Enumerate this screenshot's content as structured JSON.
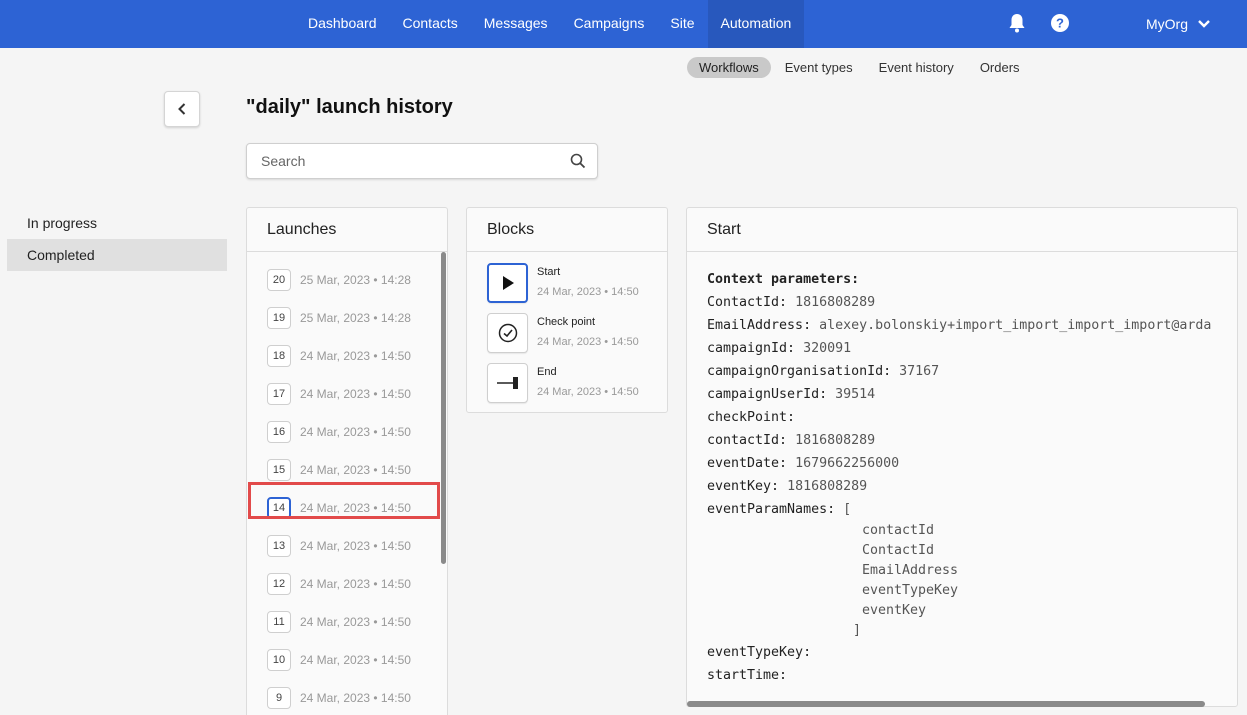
{
  "nav": {
    "items": [
      "Dashboard",
      "Contacts",
      "Messages",
      "Campaigns",
      "Site",
      "Automation"
    ],
    "active": "Automation",
    "org": "MyOrg"
  },
  "subnav": {
    "items": [
      "Workflows",
      "Event types",
      "Event history",
      "Orders"
    ],
    "active": "Workflows"
  },
  "page_title": "\"daily\" launch history",
  "search": {
    "placeholder": "Search"
  },
  "status_filters": [
    "In progress",
    "Completed"
  ],
  "status_active": "Completed",
  "launches": {
    "title": "Launches",
    "rows": [
      {
        "num": "20",
        "date": "25 Mar, 2023 • 14:28"
      },
      {
        "num": "19",
        "date": "25 Mar, 2023 • 14:28"
      },
      {
        "num": "18",
        "date": "24 Mar, 2023 • 14:50"
      },
      {
        "num": "17",
        "date": "24 Mar, 2023 • 14:50"
      },
      {
        "num": "16",
        "date": "24 Mar, 2023 • 14:50"
      },
      {
        "num": "15",
        "date": "24 Mar, 2023 • 14:50"
      },
      {
        "num": "14",
        "date": "24 Mar, 2023 • 14:50"
      },
      {
        "num": "13",
        "date": "24 Mar, 2023 • 14:50"
      },
      {
        "num": "12",
        "date": "24 Mar, 2023 • 14:50"
      },
      {
        "num": "11",
        "date": "24 Mar, 2023 • 14:50"
      },
      {
        "num": "10",
        "date": "24 Mar, 2023 • 14:50"
      },
      {
        "num": "9",
        "date": "24 Mar, 2023 • 14:50"
      }
    ],
    "selected": "14"
  },
  "blocks": {
    "title": "Blocks",
    "rows": [
      {
        "name": "Start",
        "date": "24 Mar, 2023 • 14:50",
        "icon": "play-icon"
      },
      {
        "name": "Check point",
        "date": "24 Mar, 2023 • 14:50",
        "icon": "check-circle-icon"
      },
      {
        "name": "End",
        "date": "24 Mar, 2023 • 14:50",
        "icon": "end-icon"
      }
    ],
    "selected": "Start"
  },
  "detail": {
    "title": "Start",
    "context_title": "Context parameters:",
    "params": [
      {
        "key": "ContactId:",
        "value": "1816808289"
      },
      {
        "key": "EmailAddress:",
        "value": "alexey.bolonskiy+import_import_import_import@arda"
      },
      {
        "key": "campaignId:",
        "value": "320091"
      },
      {
        "key": "campaignOrganisationId:",
        "value": "37167"
      },
      {
        "key": "campaignUserId:",
        "value": "39514"
      },
      {
        "key": "checkPoint:",
        "value": ""
      },
      {
        "key": "contactId:",
        "value": "1816808289"
      },
      {
        "key": "eventDate:",
        "value": "1679662256000"
      },
      {
        "key": "eventKey:",
        "value": "1816808289"
      },
      {
        "key": "eventParamNames:",
        "value": "["
      }
    ],
    "param_names": [
      "contactId",
      "ContactId",
      "EmailAddress",
      "eventTypeKey",
      "eventKey"
    ],
    "param_names_close": "]",
    "params_after": [
      {
        "key": "eventTypeKey:",
        "value": ""
      },
      {
        "key": "startTime:",
        "value": ""
      }
    ]
  }
}
